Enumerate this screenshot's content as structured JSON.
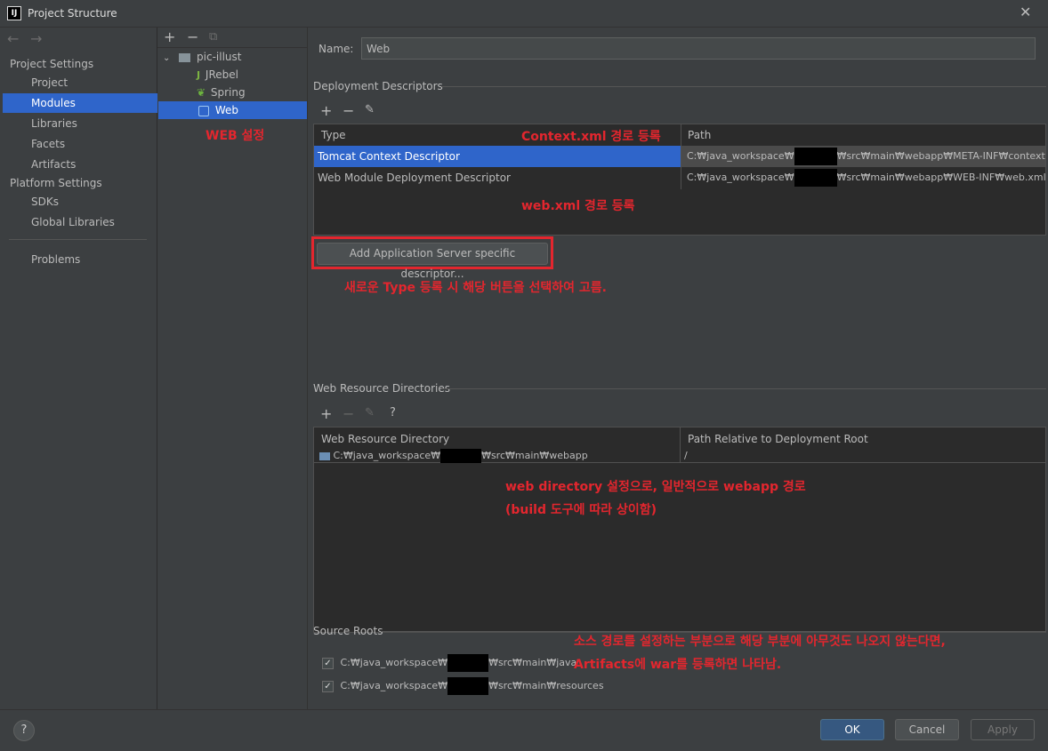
{
  "window": {
    "title": "Project Structure"
  },
  "nav": {
    "project_settings": "Project Settings",
    "items_ps": [
      "Project",
      "Modules",
      "Libraries",
      "Facets",
      "Artifacts"
    ],
    "platform_settings": "Platform Settings",
    "items_pl": [
      "SDKs",
      "Global Libraries"
    ],
    "problems": "Problems"
  },
  "tree": {
    "root": "pic-illust",
    "children": [
      "JRebel",
      "Spring",
      "Web"
    ]
  },
  "main": {
    "name_label": "Name:",
    "name_value": "Web",
    "deploy_title": "Deployment Descriptors",
    "deploy_headers": [
      "Type",
      "Path"
    ],
    "deploy_rows": [
      {
        "type": "Tomcat Context Descriptor",
        "path_pre": "C:₩java_workspace₩",
        "path_post": "₩src₩main₩webapp₩META-INF₩context.xml"
      },
      {
        "type": "Web Module Deployment Descriptor",
        "path_pre": "C:₩java_workspace₩",
        "path_post": "₩src₩main₩webapp₩WEB-INF₩web.xml"
      }
    ],
    "add_server_btn": "Add Application Server specific descriptor...",
    "web_res_title": "Web Resource Directories",
    "web_res_headers": [
      "Web Resource Directory",
      "Path Relative to Deployment Root"
    ],
    "web_res_row": {
      "pre": "C:₩java_workspace₩",
      "post": "₩src₩main₩webapp",
      "rel": "/"
    },
    "source_roots_title": "Source Roots",
    "source_roots": [
      {
        "pre": "C:₩java_workspace₩",
        "post": "₩src₩main₩java"
      },
      {
        "pre": "C:₩java_workspace₩",
        "post": "₩src₩main₩resources"
      }
    ]
  },
  "annotations": {
    "web_setting": "WEB 설정",
    "context_xml": "Context.xml 경로 등록",
    "web_xml": "web.xml  경로 등록",
    "new_type": "새로운 Type 등록 시 해당 버튼을 선택하여 고름.",
    "web_dir_1": "web directory 설정으로, 일반적으로 webapp 경로",
    "web_dir_2": "(build 도구에 따라 상이함)",
    "source_1": "소스 경로를 설정하는 부분으로 해당 부분에 아무것도 나오지 않는다면,",
    "source_2": "Artifacts에 war를 등록하면 나타남."
  },
  "footer": {
    "help": "?",
    "ok": "OK",
    "cancel": "Cancel",
    "apply": "Apply"
  },
  "colors": {
    "accent": "#2f65ca",
    "annotation": "#e3262e",
    "bg": "#3c3f41"
  }
}
